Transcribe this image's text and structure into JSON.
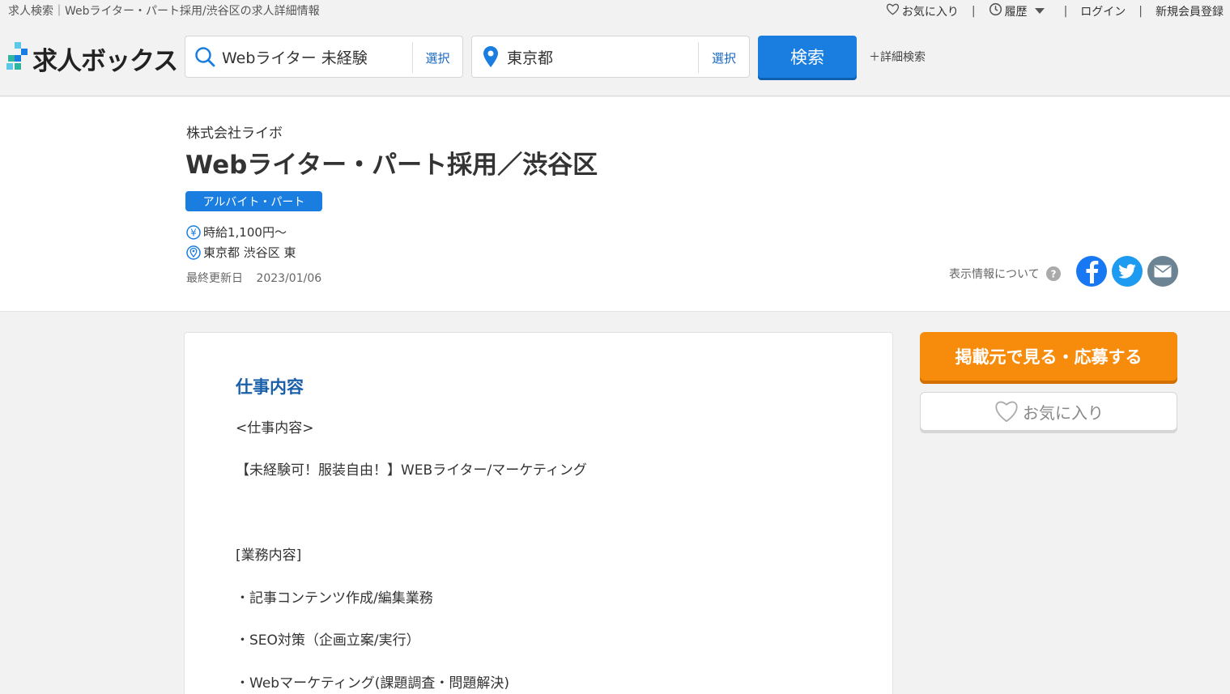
{
  "page_title": "求人検索｜Webライター・パート採用/渋谷区の求人詳細情報",
  "topnav": {
    "favorites": "お気に入り",
    "history": "履歴",
    "login": "ログイン",
    "signup": "新規会員登録",
    "separator": "|"
  },
  "logo": {
    "text": "求人ボックス"
  },
  "search": {
    "keyword": "Webライター 未経験",
    "keyword_select": "選択",
    "location": "東京都",
    "location_select": "選択",
    "submit": "検索",
    "detail": "＋詳細検索"
  },
  "job": {
    "company": "株式会社ライボ",
    "title": "Webライター・パート採用／渋谷区",
    "employment_type": "アルバイト・パート",
    "salary": "時給1,100円～",
    "location": "東京都 渋谷区 東",
    "updated_label": "最終更新日",
    "updated_date": "2023/01/06",
    "display_info": "表示情報について"
  },
  "content": {
    "section_title": "仕事内容",
    "lines": [
      "<仕事内容>",
      "【未経験可！服装自由！】WEBライター/マーケティング",
      "[業務内容]",
      "・記事コンテンツ作成/編集業務",
      "・SEO対策（企画立案/実行）",
      "・Webマーケティング(課題調査・問題解決)"
    ]
  },
  "sidebar": {
    "apply": "掲載元で見る・応募する",
    "favorite": "お気に入り"
  },
  "colors": {
    "accent_blue": "#1a7ee0",
    "apply_orange": "#f78b0c",
    "section_blue": "#1a5faa",
    "facebook": "#1877f2",
    "twitter": "#1d9bf0",
    "mail": "#6b8393"
  }
}
